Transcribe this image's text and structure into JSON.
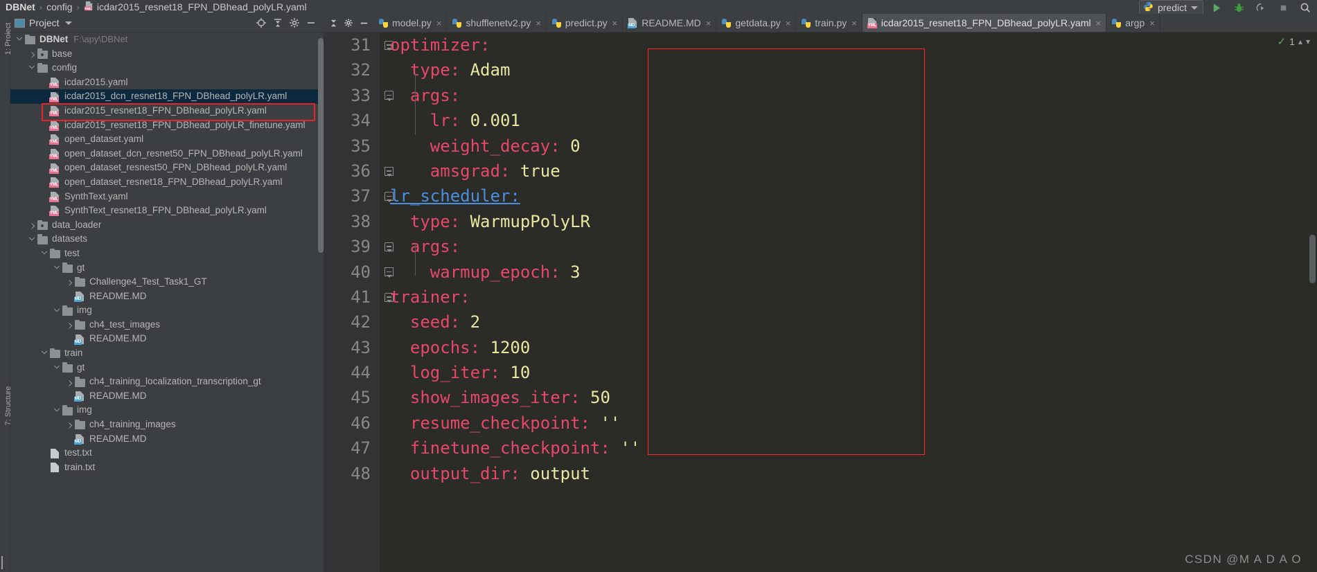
{
  "breadcrumb": {
    "project": "DBNet",
    "folder": "config",
    "file": "icdar2015_resnet18_FPN_DBhead_polyLR.yaml",
    "separator": "›"
  },
  "runbar": {
    "config_name": "predict",
    "run_title": "Run",
    "debug_title": "Debug",
    "coverage_title": "Run with Coverage",
    "stop_title": "Stop",
    "search_title": "Search Everywhere"
  },
  "vstrip": {
    "project_label": "1: Project",
    "structure_label": "7: Structure"
  },
  "panel": {
    "title": "Project",
    "locate_title": "Select Opened File",
    "collapse_title": "Collapse All",
    "settings_title": "Settings",
    "hide_title": "Hide"
  },
  "tree": {
    "selected_index": 4,
    "items": [
      {
        "indent": 0,
        "twisty": "down",
        "icon": "folder",
        "label": "DBNet",
        "sub": "F:\\apy\\DBNet",
        "bold": true
      },
      {
        "indent": 1,
        "twisty": "right",
        "icon": "folder-src",
        "label": "base",
        "sub": "",
        "bold": false
      },
      {
        "indent": 1,
        "twisty": "down",
        "icon": "folder",
        "label": "config",
        "sub": "",
        "bold": false
      },
      {
        "indent": 2,
        "twisty": "none",
        "icon": "yml",
        "label": "icdar2015.yaml",
        "sub": "",
        "bold": false
      },
      {
        "indent": 2,
        "twisty": "none",
        "icon": "yml",
        "label": "icdar2015_dcn_resnet18_FPN_DBhead_polyLR.yaml",
        "sub": "",
        "bold": false
      },
      {
        "indent": 2,
        "twisty": "none",
        "icon": "yml",
        "label": "icdar2015_resnet18_FPN_DBhead_polyLR.yaml",
        "sub": "",
        "bold": false
      },
      {
        "indent": 2,
        "twisty": "none",
        "icon": "yml",
        "label": "icdar2015_resnet18_FPN_DBhead_polyLR_finetune.yaml",
        "sub": "",
        "bold": false
      },
      {
        "indent": 2,
        "twisty": "none",
        "icon": "yml",
        "label": "open_dataset.yaml",
        "sub": "",
        "bold": false
      },
      {
        "indent": 2,
        "twisty": "none",
        "icon": "yml",
        "label": "open_dataset_dcn_resnet50_FPN_DBhead_polyLR.yaml",
        "sub": "",
        "bold": false
      },
      {
        "indent": 2,
        "twisty": "none",
        "icon": "yml",
        "label": "open_dataset_resnest50_FPN_DBhead_polyLR.yaml",
        "sub": "",
        "bold": false
      },
      {
        "indent": 2,
        "twisty": "none",
        "icon": "yml",
        "label": "open_dataset_resnet18_FPN_DBhead_polyLR.yaml",
        "sub": "",
        "bold": false
      },
      {
        "indent": 2,
        "twisty": "none",
        "icon": "yml",
        "label": "SynthText.yaml",
        "sub": "",
        "bold": false
      },
      {
        "indent": 2,
        "twisty": "none",
        "icon": "yml",
        "label": "SynthText_resnet18_FPN_DBhead_polyLR.yaml",
        "sub": "",
        "bold": false
      },
      {
        "indent": 1,
        "twisty": "right",
        "icon": "folder-src",
        "label": "data_loader",
        "sub": "",
        "bold": false
      },
      {
        "indent": 1,
        "twisty": "down",
        "icon": "folder",
        "label": "datasets",
        "sub": "",
        "bold": false
      },
      {
        "indent": 2,
        "twisty": "down",
        "icon": "folder",
        "label": "test",
        "sub": "",
        "bold": false
      },
      {
        "indent": 3,
        "twisty": "down",
        "icon": "folder",
        "label": "gt",
        "sub": "",
        "bold": false
      },
      {
        "indent": 4,
        "twisty": "right",
        "icon": "folder",
        "label": "Challenge4_Test_Task1_GT",
        "sub": "",
        "bold": false
      },
      {
        "indent": 4,
        "twisty": "none",
        "icon": "md",
        "label": "README.MD",
        "sub": "",
        "bold": false
      },
      {
        "indent": 3,
        "twisty": "down",
        "icon": "folder",
        "label": "img",
        "sub": "",
        "bold": false
      },
      {
        "indent": 4,
        "twisty": "right",
        "icon": "folder",
        "label": "ch4_test_images",
        "sub": "",
        "bold": false
      },
      {
        "indent": 4,
        "twisty": "none",
        "icon": "md",
        "label": "README.MD",
        "sub": "",
        "bold": false
      },
      {
        "indent": 2,
        "twisty": "down",
        "icon": "folder",
        "label": "train",
        "sub": "",
        "bold": false
      },
      {
        "indent": 3,
        "twisty": "down",
        "icon": "folder",
        "label": "gt",
        "sub": "",
        "bold": false
      },
      {
        "indent": 4,
        "twisty": "right",
        "icon": "folder",
        "label": "ch4_training_localization_transcription_gt",
        "sub": "",
        "bold": false
      },
      {
        "indent": 4,
        "twisty": "none",
        "icon": "md",
        "label": "README.MD",
        "sub": "",
        "bold": false
      },
      {
        "indent": 3,
        "twisty": "down",
        "icon": "folder",
        "label": "img",
        "sub": "",
        "bold": false
      },
      {
        "indent": 4,
        "twisty": "right",
        "icon": "folder",
        "label": "ch4_training_images",
        "sub": "",
        "bold": false
      },
      {
        "indent": 4,
        "twisty": "none",
        "icon": "md",
        "label": "README.MD",
        "sub": "",
        "bold": false
      },
      {
        "indent": 2,
        "twisty": "none",
        "icon": "txt",
        "label": "test.txt",
        "sub": "",
        "bold": false
      },
      {
        "indent": 2,
        "twisty": "none",
        "icon": "txt",
        "label": "train.txt",
        "sub": "",
        "bold": false
      }
    ]
  },
  "tabs": {
    "items": [
      {
        "label": "model.py",
        "icon": "py",
        "active": false
      },
      {
        "label": "shufflenetv2.py",
        "icon": "py",
        "active": false
      },
      {
        "label": "predict.py",
        "icon": "py",
        "active": false
      },
      {
        "label": "README.MD",
        "icon": "md",
        "active": false
      },
      {
        "label": "getdata.py",
        "icon": "py",
        "active": false
      },
      {
        "label": "train.py",
        "icon": "py",
        "active": false
      },
      {
        "label": "icdar2015_resnet18_FPN_DBhead_polyLR.yaml",
        "icon": "yml",
        "active": true
      },
      {
        "label": "argp",
        "icon": "py",
        "active": false
      }
    ],
    "close_glyph": "×"
  },
  "editor": {
    "first_line": 31,
    "inspection_count": "1",
    "lines": [
      {
        "no": 31,
        "indent": 0,
        "fold": "top",
        "key": "optimizer:",
        "value": ""
      },
      {
        "no": 32,
        "indent": 1,
        "fold": "none",
        "key": "type:",
        "value": "Adam"
      },
      {
        "no": 33,
        "indent": 1,
        "fold": "top",
        "key": "args:",
        "value": ""
      },
      {
        "no": 34,
        "indent": 2,
        "fold": "none",
        "key": "lr:",
        "value": "0.001"
      },
      {
        "no": 35,
        "indent": 2,
        "fold": "none",
        "key": "weight_decay:",
        "value": "0"
      },
      {
        "no": 36,
        "indent": 2,
        "fold": "end",
        "key": "amsgrad:",
        "value": "true"
      },
      {
        "no": 37,
        "indent": 0,
        "fold": "top",
        "key": "lr_scheduler:",
        "value": "",
        "link": true
      },
      {
        "no": 38,
        "indent": 1,
        "fold": "none",
        "key": "type:",
        "value": "WarmupPolyLR"
      },
      {
        "no": 39,
        "indent": 1,
        "fold": "top",
        "key": "args:",
        "value": ""
      },
      {
        "no": 40,
        "indent": 2,
        "fold": "end",
        "key": "warmup_epoch:",
        "value": "3"
      },
      {
        "no": 41,
        "indent": 0,
        "fold": "top",
        "key": "trainer:",
        "value": ""
      },
      {
        "no": 42,
        "indent": 1,
        "fold": "none",
        "key": "seed:",
        "value": "2"
      },
      {
        "no": 43,
        "indent": 1,
        "fold": "none",
        "key": "epochs:",
        "value": "1200"
      },
      {
        "no": 44,
        "indent": 1,
        "fold": "none",
        "key": "log_iter:",
        "value": "10"
      },
      {
        "no": 45,
        "indent": 1,
        "fold": "none",
        "key": "show_images_iter:",
        "value": "50"
      },
      {
        "no": 46,
        "indent": 1,
        "fold": "none",
        "key": "resume_checkpoint:",
        "value": "''"
      },
      {
        "no": 47,
        "indent": 1,
        "fold": "none",
        "key": "finetune_checkpoint:",
        "value": "''"
      },
      {
        "no": 48,
        "indent": 1,
        "fold": "none",
        "key": "output_dir:",
        "value": "output"
      }
    ]
  },
  "colors": {
    "key": "#e8486a",
    "value": "#e8e8a0",
    "link": "#4b8fe0",
    "annotation": "#ff2b2b",
    "selection": "#0d293e",
    "editor_bg": "#2b2b28",
    "panel_bg": "#3c3f41"
  },
  "watermark": "CSDN @M A D A O"
}
